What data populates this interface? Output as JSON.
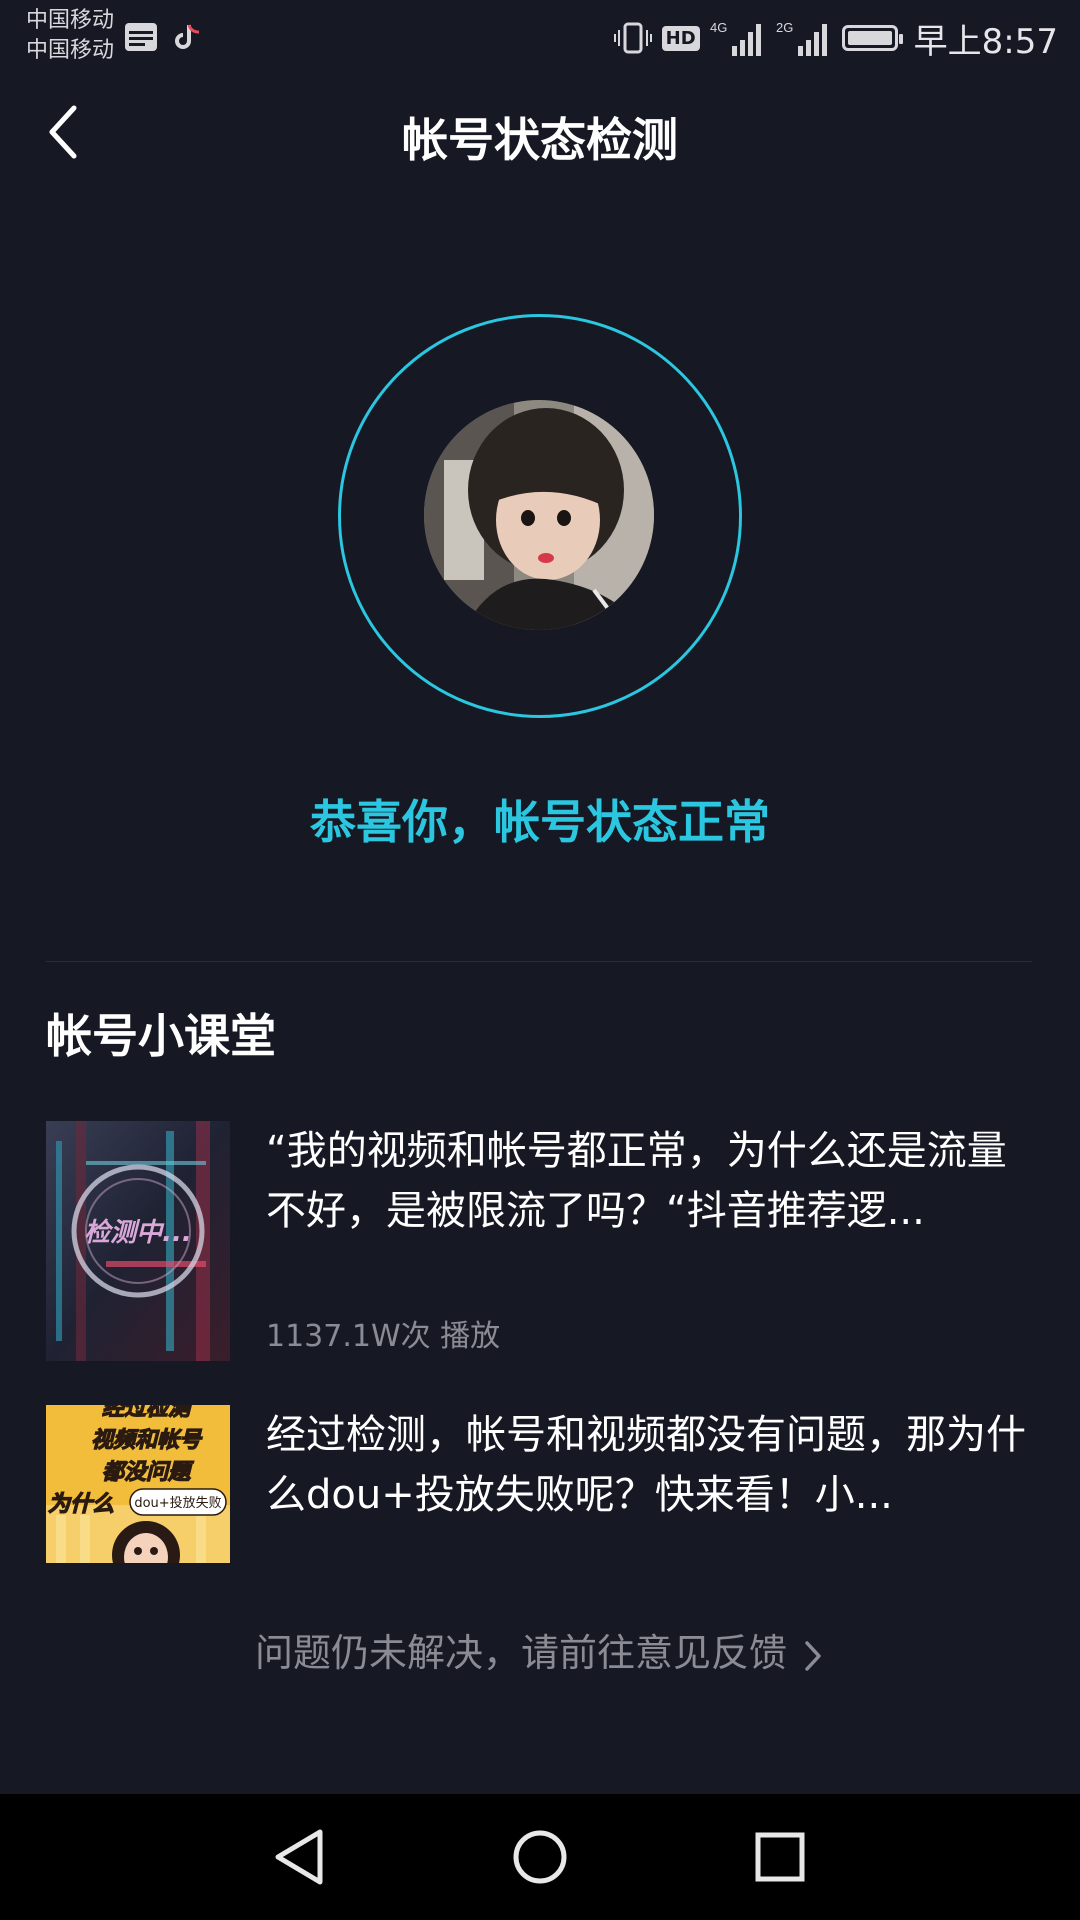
{
  "status_bar": {
    "carrier_1": "中国移动",
    "carrier_2": "中国移动",
    "network_4g": "4G",
    "network_2g": "2G",
    "hd_label": "HD",
    "time": "早上8:57",
    "app_icons": [
      "toutiao-icon",
      "douyin-icon"
    ]
  },
  "header": {
    "title": "帐号状态检测"
  },
  "detection": {
    "status_text": "恭喜你，帐号状态正常",
    "ring_color": "#2bc6df"
  },
  "course": {
    "section_title": "帐号小课堂",
    "articles": [
      {
        "title": "“我的视频和帐号都正常，为什么还是流量不好，是被限流了吗？“抖音推荐逻...",
        "plays": "1137.1W次 播放",
        "thumb_text": "检测中..."
      },
      {
        "title": "经过检测，帐号和视频都没有问题，那为什么dou+投放失败呢？快来看！小...",
        "thumb_lines": [
          "经过检测",
          "视频和帐号",
          "都没问题",
          "为什么"
        ],
        "thumb_badge": "dou+投放失败"
      }
    ]
  },
  "feedback": {
    "label": "问题仍未解决，请前往意见反馈"
  },
  "colors": {
    "background": "#161823",
    "accent": "#2bc6df",
    "muted_text": "#8a8b93"
  }
}
